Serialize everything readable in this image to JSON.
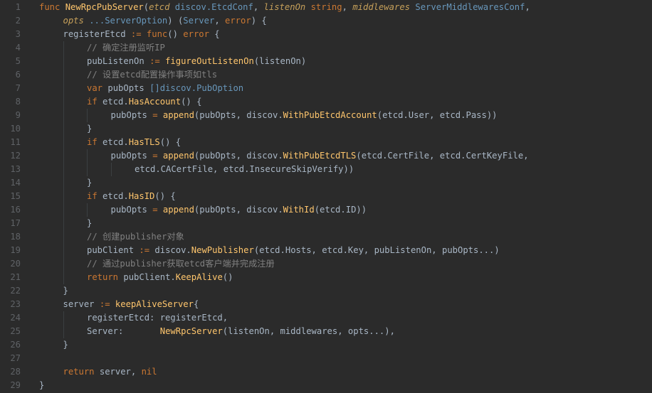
{
  "lines": [
    {
      "n": "1",
      "indent": 0,
      "tokens": [
        [
          "kw",
          "func "
        ],
        [
          "fn",
          "NewRpcPubServer"
        ],
        [
          "plain",
          "("
        ],
        [
          "param",
          "etcd"
        ],
        [
          "type",
          " discov.EtcdConf"
        ],
        [
          "plain",
          ", "
        ],
        [
          "param",
          "listenOn"
        ],
        [
          "kw",
          " string"
        ],
        [
          "plain",
          ", "
        ],
        [
          "param",
          "middlewares"
        ],
        [
          "type",
          " ServerMiddlewaresConf"
        ],
        [
          "plain",
          ","
        ]
      ]
    },
    {
      "n": "2",
      "indent": 1,
      "tokens": [
        [
          "param",
          "opts"
        ],
        [
          "type",
          " ...ServerOption"
        ],
        [
          "plain",
          ") ("
        ],
        [
          "type",
          "Server"
        ],
        [
          "plain",
          ", "
        ],
        [
          "kw",
          "error"
        ],
        [
          "plain",
          ") {"
        ]
      ]
    },
    {
      "n": "3",
      "indent": 1,
      "tokens": [
        [
          "plain",
          "registerEtcd "
        ],
        [
          "kw",
          ":= func"
        ],
        [
          "plain",
          "() "
        ],
        [
          "kw",
          "error"
        ],
        [
          "plain",
          " {"
        ]
      ]
    },
    {
      "n": "4",
      "indent": 2,
      "tokens": [
        [
          "cm",
          "// 确定注册监听IP"
        ]
      ]
    },
    {
      "n": "5",
      "indent": 2,
      "tokens": [
        [
          "plain",
          "pubListenOn "
        ],
        [
          "kw",
          ":= "
        ],
        [
          "call",
          "figureOutListenOn"
        ],
        [
          "plain",
          "(listenOn)"
        ]
      ]
    },
    {
      "n": "6",
      "indent": 2,
      "tokens": [
        [
          "cm",
          "// 设置etcd配置操作事项如tls"
        ]
      ]
    },
    {
      "n": "7",
      "indent": 2,
      "tokens": [
        [
          "kw",
          "var "
        ],
        [
          "plain",
          "pubOpts "
        ],
        [
          "type",
          "[]discov.PubOption"
        ]
      ]
    },
    {
      "n": "8",
      "indent": 2,
      "tokens": [
        [
          "kw",
          "if "
        ],
        [
          "plain",
          "etcd."
        ],
        [
          "call",
          "HasAccount"
        ],
        [
          "plain",
          "() {"
        ]
      ]
    },
    {
      "n": "9",
      "indent": 3,
      "tokens": [
        [
          "plain",
          "pubOpts "
        ],
        [
          "kw",
          "= "
        ],
        [
          "call",
          "append"
        ],
        [
          "plain",
          "(pubOpts, discov."
        ],
        [
          "call",
          "WithPubEtcdAccount"
        ],
        [
          "plain",
          "(etcd.User, etcd.Pass))"
        ]
      ]
    },
    {
      "n": "10",
      "indent": 2,
      "tokens": [
        [
          "plain",
          "}"
        ]
      ]
    },
    {
      "n": "11",
      "indent": 2,
      "tokens": [
        [
          "kw",
          "if "
        ],
        [
          "plain",
          "etcd."
        ],
        [
          "call",
          "HasTLS"
        ],
        [
          "plain",
          "() {"
        ]
      ]
    },
    {
      "n": "12",
      "indent": 3,
      "tokens": [
        [
          "plain",
          "pubOpts "
        ],
        [
          "kw",
          "= "
        ],
        [
          "call",
          "append"
        ],
        [
          "plain",
          "(pubOpts, discov."
        ],
        [
          "call",
          "WithPubEtcdTLS"
        ],
        [
          "plain",
          "(etcd.CertFile, etcd.CertKeyFile,"
        ]
      ]
    },
    {
      "n": "13",
      "indent": 4,
      "tokens": [
        [
          "plain",
          "etcd.CACertFile, etcd.InsecureSkipVerify))"
        ]
      ]
    },
    {
      "n": "14",
      "indent": 2,
      "tokens": [
        [
          "plain",
          "}"
        ]
      ]
    },
    {
      "n": "15",
      "indent": 2,
      "tokens": [
        [
          "kw",
          "if "
        ],
        [
          "plain",
          "etcd."
        ],
        [
          "call",
          "HasID"
        ],
        [
          "plain",
          "() {"
        ]
      ]
    },
    {
      "n": "16",
      "indent": 3,
      "tokens": [
        [
          "plain",
          "pubOpts "
        ],
        [
          "kw",
          "= "
        ],
        [
          "call",
          "append"
        ],
        [
          "plain",
          "(pubOpts, discov."
        ],
        [
          "call",
          "WithId"
        ],
        [
          "plain",
          "(etcd.ID))"
        ]
      ]
    },
    {
      "n": "17",
      "indent": 2,
      "tokens": [
        [
          "plain",
          "}"
        ]
      ]
    },
    {
      "n": "18",
      "indent": 2,
      "tokens": [
        [
          "cm",
          "// 创建publisher对象"
        ]
      ]
    },
    {
      "n": "19",
      "indent": 2,
      "tokens": [
        [
          "plain",
          "pubClient "
        ],
        [
          "kw",
          ":= "
        ],
        [
          "plain",
          "discov."
        ],
        [
          "call",
          "NewPublisher"
        ],
        [
          "plain",
          "(etcd.Hosts, etcd.Key, pubListenOn, pubOpts...)"
        ]
      ]
    },
    {
      "n": "20",
      "indent": 2,
      "tokens": [
        [
          "cm",
          "// 通过publisher获取etcd客户端并完成注册"
        ]
      ]
    },
    {
      "n": "21",
      "indent": 2,
      "tokens": [
        [
          "kw",
          "return "
        ],
        [
          "plain",
          "pubClient."
        ],
        [
          "call",
          "KeepAlive"
        ],
        [
          "plain",
          "()"
        ]
      ]
    },
    {
      "n": "22",
      "indent": 1,
      "tokens": [
        [
          "plain",
          "}"
        ]
      ]
    },
    {
      "n": "23",
      "indent": 1,
      "tokens": [
        [
          "plain",
          "server "
        ],
        [
          "kw",
          ":= "
        ],
        [
          "call",
          "keepAliveServer"
        ],
        [
          "plain",
          "{"
        ]
      ]
    },
    {
      "n": "24",
      "indent": 2,
      "tokens": [
        [
          "plain",
          "registerEtcd: registerEtcd,"
        ]
      ]
    },
    {
      "n": "25",
      "indent": 2,
      "tokens": [
        [
          "plain",
          "Server:       "
        ],
        [
          "call",
          "NewRpcServer"
        ],
        [
          "plain",
          "(listenOn, middlewares, opts...),"
        ]
      ]
    },
    {
      "n": "26",
      "indent": 1,
      "tokens": [
        [
          "plain",
          "}"
        ]
      ]
    },
    {
      "n": "27",
      "indent": 0,
      "tokens": []
    },
    {
      "n": "28",
      "indent": 1,
      "tokens": [
        [
          "kw",
          "return "
        ],
        [
          "plain",
          "server, "
        ],
        [
          "kw",
          "nil"
        ]
      ]
    },
    {
      "n": "29",
      "indent": 0,
      "tokens": [
        [
          "plain",
          "}"
        ]
      ]
    }
  ]
}
